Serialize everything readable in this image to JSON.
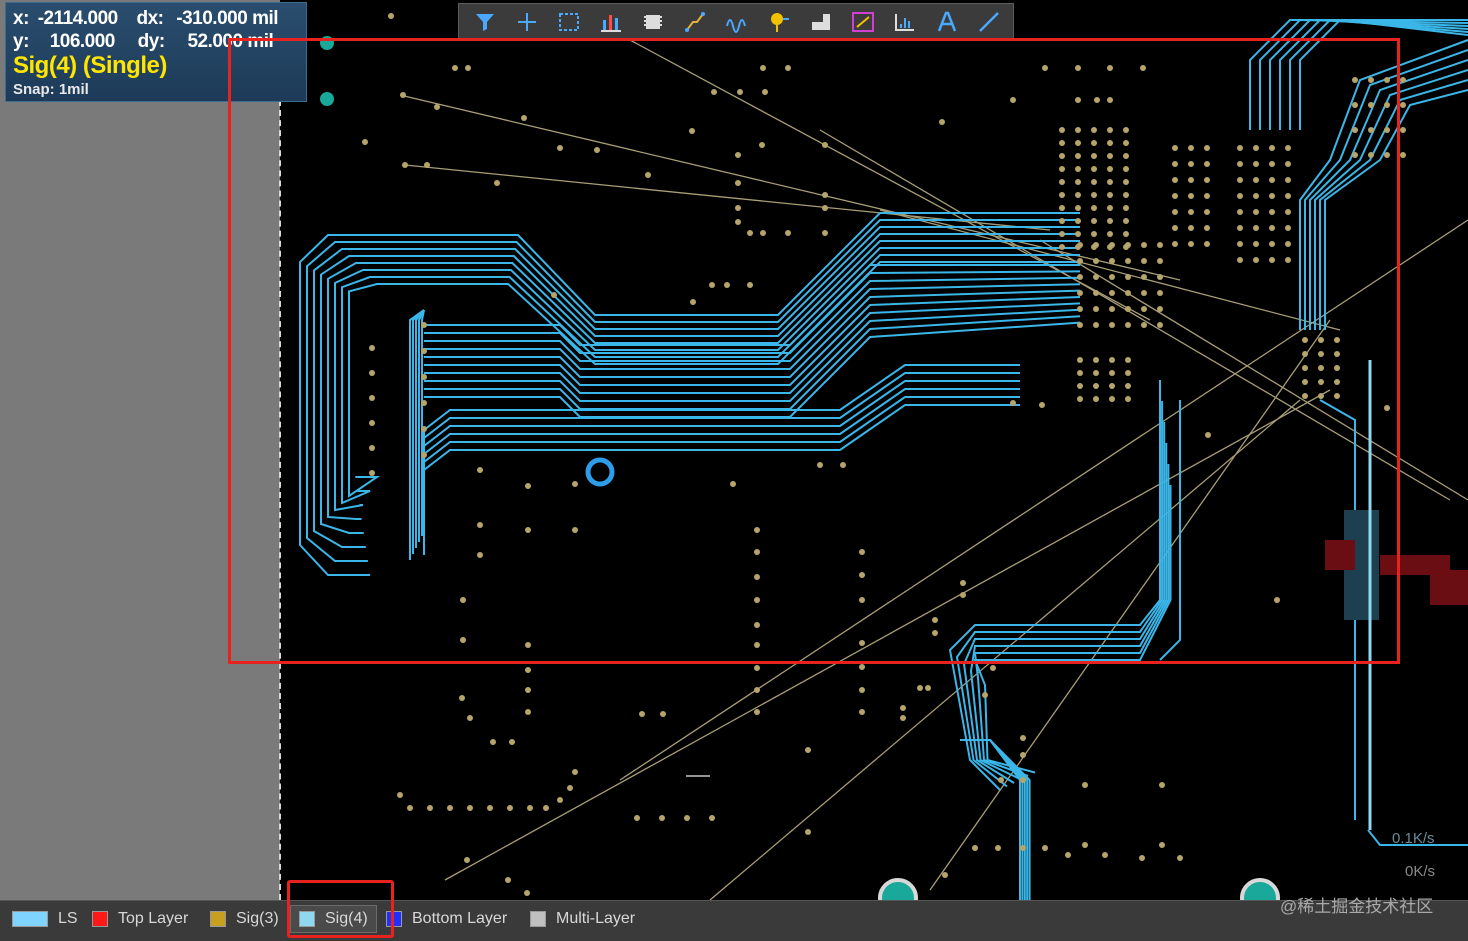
{
  "hud": {
    "x_label": "x:",
    "x_value": "-2114.000",
    "dx_label": "dx:",
    "dx_value": "-310.000 mil",
    "y_label": "y:",
    "y_value": "106.000",
    "dy_label": "dy:",
    "dy_value": "52.000 mil",
    "layer_mode": "Sig(4) (Single)",
    "snap": "Snap: 1mil"
  },
  "toolbar": {
    "icons": [
      "filter-icon",
      "cross-select-icon",
      "select-rect-icon",
      "bar-chart-icon",
      "component-icon",
      "route-icon",
      "interactive-route-icon",
      "pin-icon",
      "polygon-icon",
      "line-icon",
      "dimension-icon",
      "text-icon",
      "draw-line-icon"
    ]
  },
  "layers": [
    {
      "label": "LS",
      "color": "#7fd4ff"
    },
    {
      "label": "Top Layer",
      "color": "#ff1a1a"
    },
    {
      "label": "Sig(3)",
      "color": "#c8a020"
    },
    {
      "label": "Sig(4)",
      "color": "#8fd8f0"
    },
    {
      "label": "Bottom Layer",
      "color": "#2030ff"
    },
    {
      "label": "Multi-Layer",
      "color": "#c0c0c0"
    }
  ],
  "speed": {
    "up": "0.1K/s",
    "down": "0K/s"
  },
  "watermark": "@稀土掘金技术社区",
  "colors": {
    "trace": "#3ab6e8",
    "via": "#b6a56a",
    "ratsnest": "#a89e76",
    "highlight": "#e8231f"
  }
}
